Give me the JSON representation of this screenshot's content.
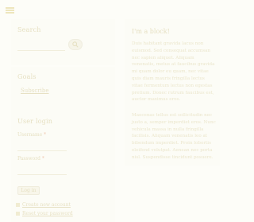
{
  "sidebar": {
    "search": {
      "heading": "Search",
      "input_value": "",
      "button_icon": "search-icon"
    },
    "goals": {
      "heading": "Goals",
      "link_label": "Subscribe"
    },
    "login": {
      "heading": "User login",
      "username_label": "Username",
      "password_label": "Password",
      "required_marker": "*",
      "submit_label": "Log in",
      "links": [
        {
          "label": "Create new account"
        },
        {
          "label": "Reset your password"
        }
      ]
    }
  },
  "main": {
    "title": "I'm a block!",
    "paragraph_1": "Duis habitant gravida lacus non euismod. Sed consequat accumsan nec sapien aliquet. Aliquam venenatis, metus at faucibus gravida mi quam dolor eu quam, nec vitae quis diam mauris fringilla lectus vitae fermentum lectus non egestas pretium. Donec rutrum faucibus est, auctor maximus eros.",
    "paragraph_2": "Maecenas tellus est sollicitudin nec justo a, semper imperdiet eros. Nunc vehicula massa in nulla fringilla facilisis. Aliquam venenatis leo at bibendum imperdiet. Proin lobortis eleifend volutpat. Aenean nec porta nisl. Suspendisse tincidunt posuere."
  },
  "colors": {
    "background": "#fdfdf8",
    "panel": "#fcfcf6",
    "text": "#e8e4cc"
  }
}
